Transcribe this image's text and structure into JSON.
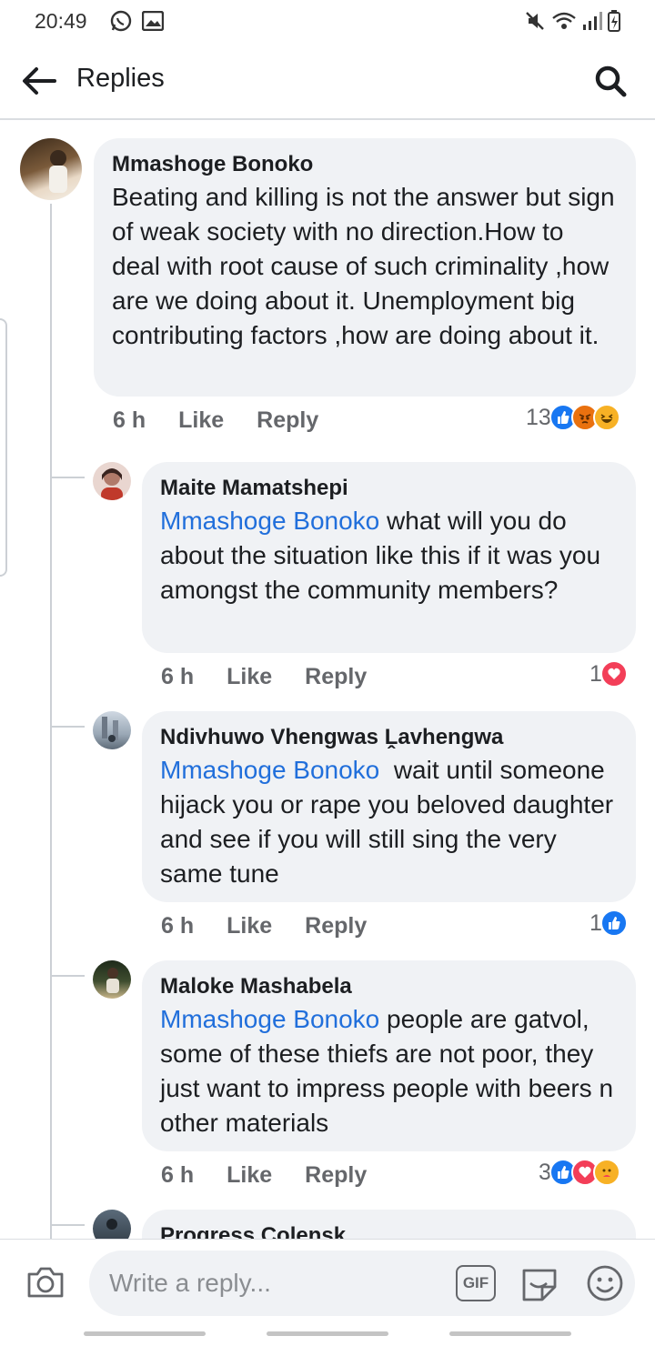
{
  "status_bar": {
    "time": "20:49"
  },
  "header": {
    "title": "Replies"
  },
  "colors": {
    "mention": "#216fdb",
    "bubble": "#f0f2f5",
    "like_blue": "#1877f2",
    "love_red": "#f33e58",
    "divider": "#dadde1"
  },
  "comments": [
    {
      "author": "Mmashoge Bonoko",
      "text": "Beating and killing is not the answer but sign of weak society with no direction.How to deal with root cause of such criminality ,how are we doing about it. Unemployment big contributing factors ,how are doing about it.",
      "time": "6 h",
      "like": "Like",
      "reply": "Reply",
      "reaction_count": "13",
      "reactions": [
        "like-icon",
        "angry-icon",
        "haha-icon"
      ]
    },
    {
      "author": "Maite Mamatshepi",
      "mention": "Mmashoge Bonoko",
      "text": " what will you do about the situation like this if it was you amongst the community members?",
      "time": "6 h",
      "like": "Like",
      "reply": "Reply",
      "reaction_count": "1",
      "reactions": [
        "love-icon"
      ]
    },
    {
      "author": "Ndivhuwo Vhengwas Ḽavhengwa",
      "mention": "Mmashoge Bonoko",
      "text": "  wait until someone hijack you or rape you beloved daughter and see if you will still sing the very same tune",
      "time": "6 h",
      "like": "Like",
      "reply": "Reply",
      "reaction_count": "1",
      "reactions": [
        "like-icon"
      ]
    },
    {
      "author": "Maloke Mashabela",
      "mention": "Mmashoge Bonoko",
      "text": " people are gatvol, some of these thiefs are not poor, they just want to impress people with beers n other materials",
      "time": "6 h",
      "like": "Like",
      "reply": "Reply",
      "reaction_count": "3",
      "reactions": [
        "like-icon",
        "love-icon",
        "care-icon"
      ]
    },
    {
      "author": "Progress Colensk"
    }
  ],
  "composer": {
    "placeholder": "Write a reply...",
    "gif": "GIF"
  }
}
